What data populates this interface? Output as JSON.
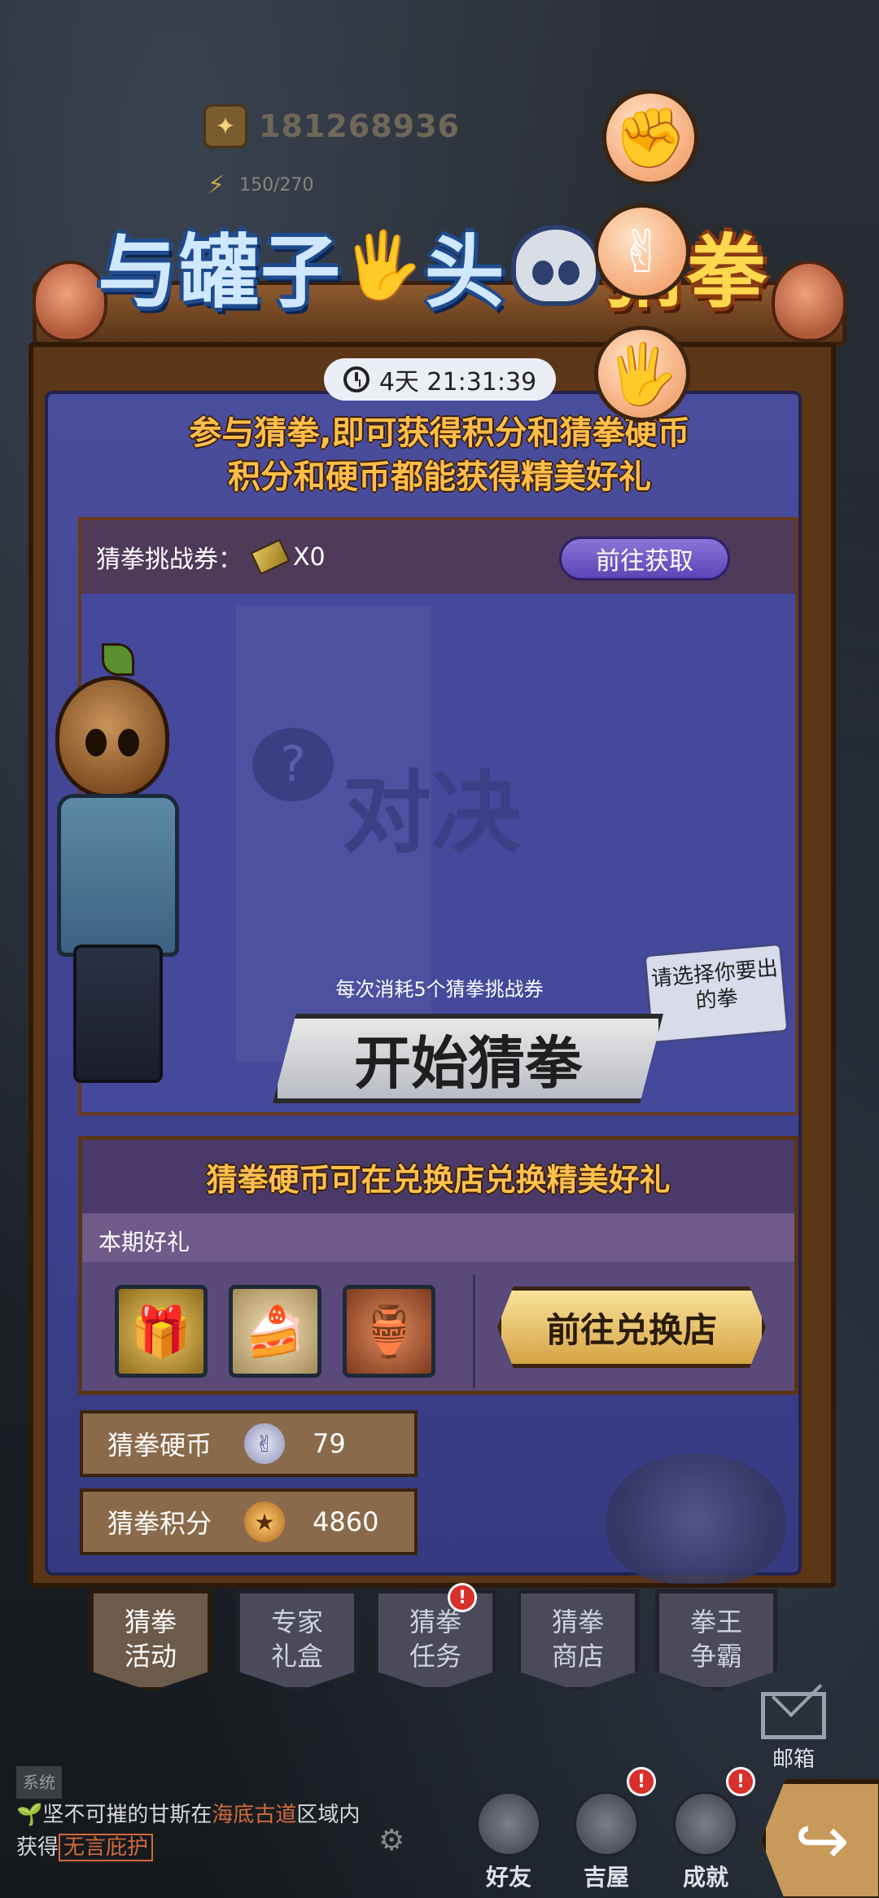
{
  "header": {
    "currency_value": "181268936",
    "energy": "150/270"
  },
  "banner": {
    "title_part1": "与罐子",
    "title_part2": "头",
    "title_part3": "猜拳"
  },
  "timer": {
    "text": "4天 21:31:39"
  },
  "intro": {
    "line1": "参与猜拳,即可获得积分和猜拳硬币",
    "line2": "积分和硬币都能获得精美好礼"
  },
  "battle": {
    "ticket_label": "猜拳挑战券：",
    "ticket_count": "X0",
    "get_button": "前往获取",
    "duel_text": "对决",
    "hint": "请选择你要出的拳",
    "cost_text": "每次消耗5个猜拳挑战券",
    "start_button": "开始猜拳"
  },
  "exchange": {
    "header": "猜拳硬币可在兑换店兑换精美好礼",
    "subheader": "本期好礼",
    "shop_button": "前往兑换店"
  },
  "stats": {
    "coin_label": "猜拳硬币",
    "coin_value": "79",
    "score_label": "猜拳积分",
    "score_value": "4860"
  },
  "tabs": [
    {
      "line1": "猜拳",
      "line2": "活动",
      "active": true
    },
    {
      "line1": "专家",
      "line2": "礼盒",
      "active": false
    },
    {
      "line1": "猜拳",
      "line2": "任务",
      "active": false,
      "badge": "!"
    },
    {
      "line1": "猜拳",
      "line2": "商店",
      "active": false
    },
    {
      "line1": "拳王",
      "line2": "争霸",
      "active": false
    }
  ],
  "bottom": {
    "mail_label": "邮箱",
    "chat_tag": "系统",
    "chat_prefix": "坚不可摧的甘斯在",
    "chat_place": "海底古道",
    "chat_mid": "区域内获得",
    "chat_item": "无言庇护",
    "nav_friends": "好友",
    "nav_house": "吉屋",
    "nav_achieve": "成就",
    "badge_mark": "!"
  },
  "colors": {
    "panel_blue": "#4a4d9c",
    "frame_brown": "#5b3617",
    "accent_gold": "#ffbe4a"
  }
}
